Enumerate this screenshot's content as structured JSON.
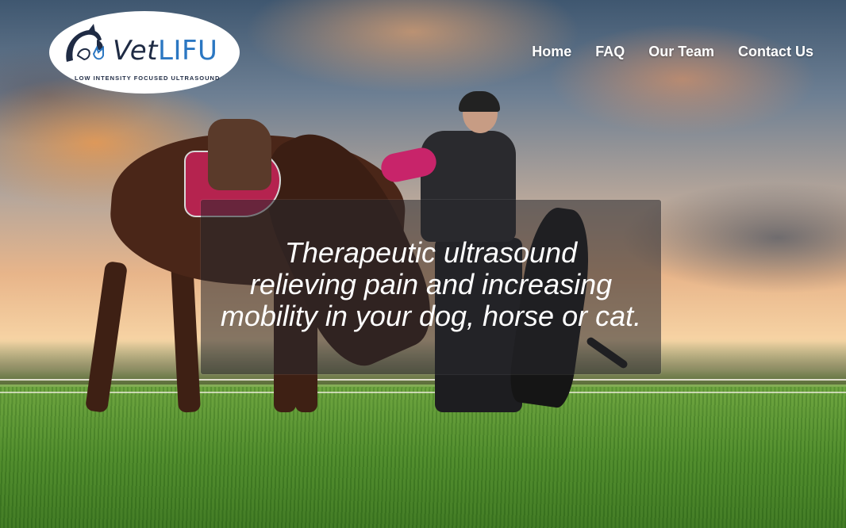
{
  "logo": {
    "word_vet": "Vet",
    "word_lifu": "LIFU",
    "tagline": "LOW INTENSITY FOCUSED ULTRASOUND",
    "icon": "horse-dog-cat-icon",
    "colors": {
      "navy": "#1f2b44",
      "blue": "#2b77c2"
    }
  },
  "nav": {
    "items": [
      {
        "label": "Home"
      },
      {
        "label": "FAQ"
      },
      {
        "label": "Our Team"
      },
      {
        "label": "Contact Us"
      }
    ]
  },
  "hero": {
    "image": "horse-woman-dog-meadow-sunset-photo",
    "caption_lines": [
      "Therapeutic ultrasound",
      "relieving pain and increasing",
      "mobility in your dog, horse or cat."
    ]
  }
}
